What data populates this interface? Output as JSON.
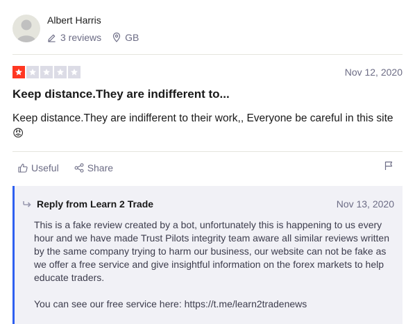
{
  "reviewer": {
    "name": "Albert Harris",
    "reviews_count": "3 reviews",
    "country": "GB",
    "icons": {
      "reviews": "pencil-icon",
      "country": "location-pin-icon",
      "avatar": "user-silhouette-icon"
    }
  },
  "review": {
    "rating": 1,
    "max_rating": 5,
    "date": "Nov 12, 2020",
    "title": "Keep distance.They are indifferent to...",
    "text": "Keep distance.They are indifferent to their work,, Everyone be careful in this site",
    "emoji": "😡"
  },
  "actions": {
    "useful_label": "Useful",
    "share_label": "Share",
    "icons": {
      "useful": "thumbs-up-icon",
      "share": "share-icon",
      "flag": "flag-icon"
    }
  },
  "reply": {
    "heading": "Reply from Learn 2 Trade",
    "date": "Nov 13, 2020",
    "paragraphs": [
      "This is a fake review created by a bot, unfortunately this is happening to us every hour and we have made Trust Pilots integrity team aware all similar reviews written by the same company trying to harm our business, our website can not be fake as we offer a free service and give insightful information on the forex markets to help educate traders.",
      "You can see our free service here: https://t.me/learn2tradenews"
    ]
  },
  "colors": {
    "star_filled": "#ff3722",
    "star_empty": "#dcdce6",
    "accent_border": "#2e5ff0",
    "reply_bg": "#f1f1f6",
    "muted_text": "#6c6c85"
  }
}
